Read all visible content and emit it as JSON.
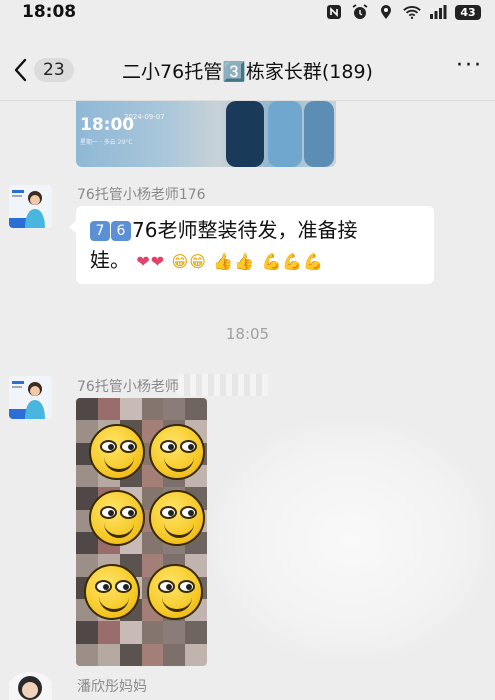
{
  "status_bar": {
    "time": "18:08",
    "battery": "43"
  },
  "header": {
    "unread_count": "23",
    "title": "二小76托管3️⃣栋家长群(189)",
    "more": "···"
  },
  "top_photo": {
    "time": "18:00",
    "date": "2024-09-07",
    "weather": "星期一 · 多云 29°C"
  },
  "messages": [
    {
      "sender": "76托管小杨老师176",
      "num_keys": [
        "7",
        "6"
      ],
      "text_line1": "76老师整装待发，准备接",
      "text_line2": "娃。",
      "emojis": {
        "hearts": "❤❤",
        "grins": "😁😁",
        "thumbs": "👍👍",
        "muscles": "💪💪💪"
      }
    },
    {
      "sender": "76托管小杨老师176 36276"
    },
    {
      "sender": "潘欣彤妈妈"
    }
  ],
  "timestamp": "18:05",
  "icons": {
    "back": "chevron-left-icon",
    "more": "more-dots-icon",
    "nfc": "nfc-icon",
    "alarm": "alarm-icon",
    "location": "location-icon",
    "wifi": "wifi-icon",
    "signal": "signal-icon",
    "battery": "battery-icon"
  },
  "colors": {
    "background": "#ededed",
    "bubble": "#ffffff",
    "sender": "#8a8a8a"
  }
}
